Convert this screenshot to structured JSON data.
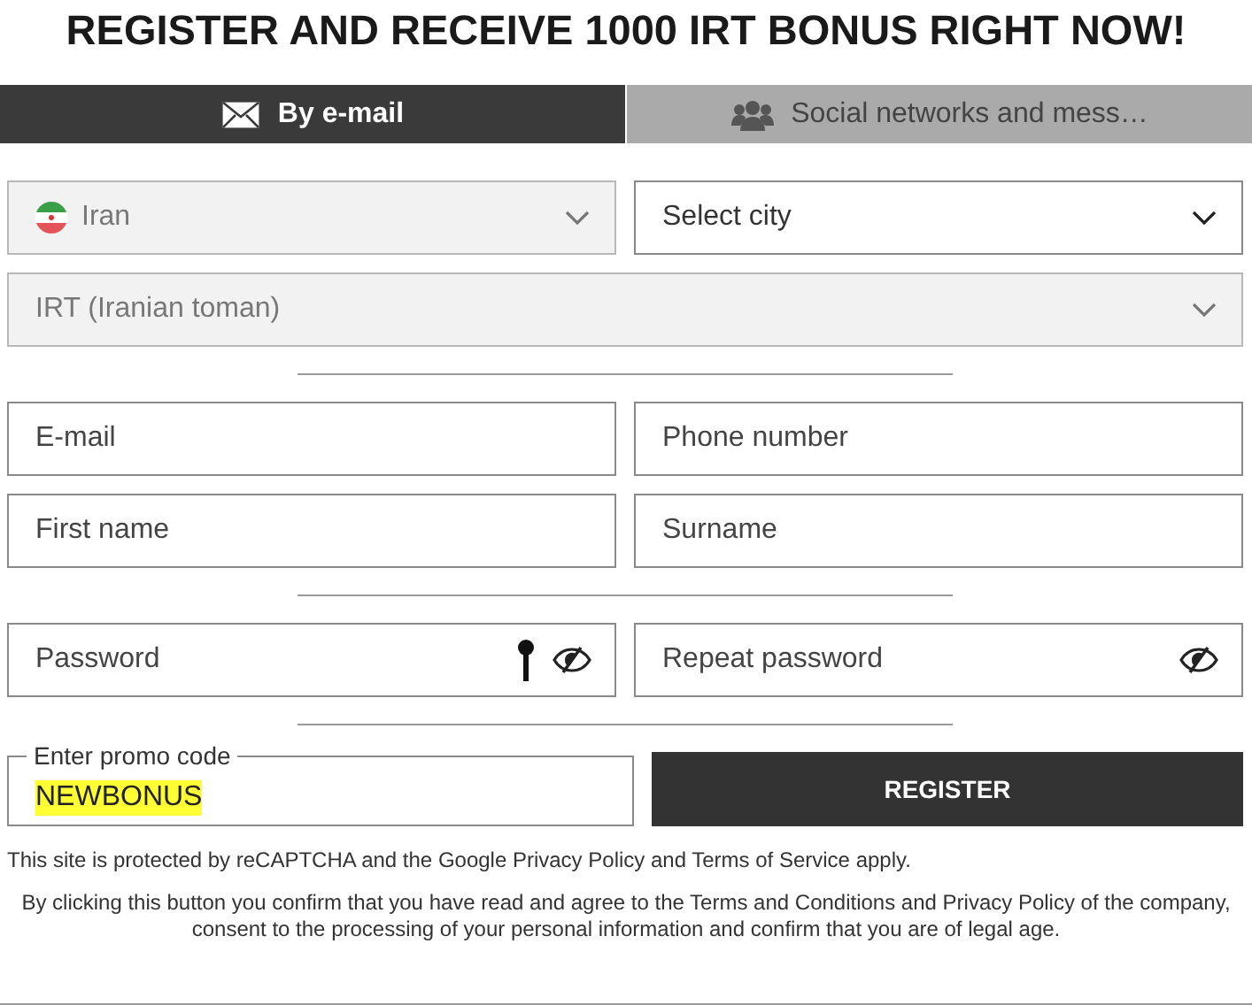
{
  "title": "REGISTER AND RECEIVE 1000 IRT BONUS RIGHT NOW!",
  "tabs": [
    {
      "label": "By e-mail",
      "kind": "email",
      "selected": true
    },
    {
      "label": "Social networks and mess…",
      "kind": "social",
      "selected": false
    }
  ],
  "sections": [
    [
      [
        {
          "kind": "country-select",
          "value": "Iran",
          "disabled": true
        },
        {
          "kind": "select",
          "placeholder": "Select city",
          "disabled": false
        }
      ],
      [
        {
          "kind": "select",
          "value": "IRT (Iranian toman)",
          "disabled": true
        }
      ]
    ],
    [
      [
        {
          "kind": "input",
          "placeholder": "E-mail"
        },
        {
          "kind": "input",
          "placeholder": "Phone number"
        }
      ],
      [
        {
          "kind": "input",
          "placeholder": "First name"
        },
        {
          "kind": "input",
          "placeholder": "Surname"
        }
      ]
    ],
    [
      [
        {
          "kind": "password",
          "placeholder": "Password",
          "key_icon": true
        },
        {
          "kind": "password",
          "placeholder": "Repeat password",
          "key_icon": false
        }
      ]
    ]
  ],
  "promo": {
    "label": "Enter promo code",
    "value": "NEWBONUS",
    "highlighted": true
  },
  "register_button": "REGISTER",
  "recaptcha_note": "This site is protected by reCAPTCHA and the Google Privacy Policy and Terms of Service apply.",
  "consent_note": "By clicking this button you confirm that you have read and agree to the Terms and Conditions and Privacy Policy of the company, consent to the processing of your personal information and confirm that you are of legal age."
}
